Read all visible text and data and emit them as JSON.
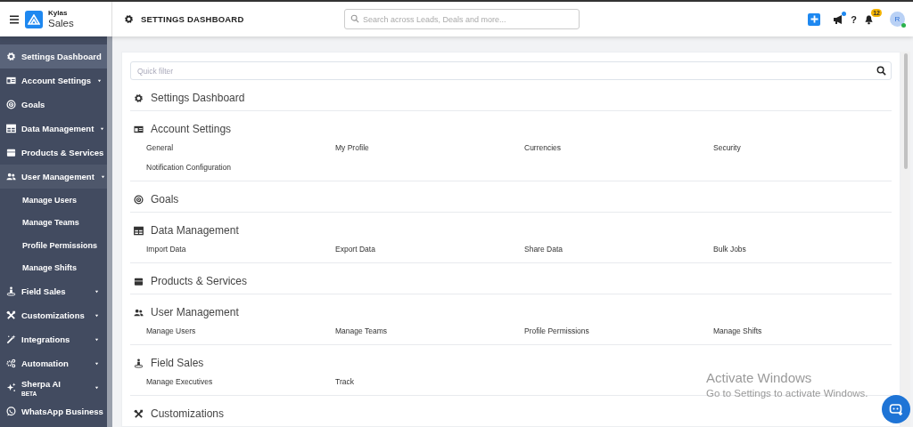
{
  "header": {
    "app_name": "Kylas",
    "product": "Sales",
    "page_title": "SETTINGS DASHBOARD",
    "search": {
      "placeholder": "Search across Leads, Deals and more..."
    },
    "help_label": "?",
    "notification_count": "12",
    "avatar": "R",
    "announcement_unread": true,
    "user_online": true
  },
  "sidebar": {
    "items": [
      {
        "label": "Settings Dashboard",
        "kind": "link",
        "selected": true
      },
      {
        "label": "Account Settings",
        "kind": "menu",
        "selected": false,
        "expanded": false
      },
      {
        "label": "Goals",
        "kind": "link",
        "selected": false
      },
      {
        "label": "Data Management",
        "kind": "menu",
        "selected": false,
        "expanded": false
      },
      {
        "label": "Products & Services",
        "kind": "link",
        "selected": false
      },
      {
        "label": "User Management",
        "kind": "menu",
        "selected": false,
        "expanded": true,
        "children": [
          {
            "label": "Manage Users",
            "selected": false
          },
          {
            "label": "Manage Teams",
            "selected": false
          },
          {
            "label": "Profile Permissions",
            "selected": false
          },
          {
            "label": "Manage Shifts",
            "selected": false
          }
        ]
      },
      {
        "label": "Field Sales",
        "kind": "menu",
        "selected": false,
        "expanded": false
      },
      {
        "label": "Customizations",
        "kind": "menu",
        "selected": false,
        "expanded": false
      },
      {
        "label": "Integrations",
        "kind": "menu",
        "selected": false,
        "expanded": false
      },
      {
        "label": "Automation",
        "kind": "menu",
        "selected": false,
        "expanded": false
      },
      {
        "label": "Sherpa AI",
        "kind": "menu",
        "selected": false,
        "expanded": false,
        "badge": "BETA"
      },
      {
        "label": "WhatsApp Business",
        "kind": "menu",
        "selected": false,
        "expanded": false
      }
    ]
  },
  "main": {
    "quick_filter": {
      "placeholder": "Quick filter"
    },
    "sections": [
      {
        "title": "Settings Dashboard"
      },
      {
        "title": "Account Settings",
        "links": [
          "General",
          "My Profile",
          "Currencies",
          "Security",
          "Notification Configuration"
        ]
      },
      {
        "title": "Goals"
      },
      {
        "title": "Data Management",
        "links": [
          "Import Data",
          "Export Data",
          "Share Data",
          "Bulk Jobs"
        ]
      },
      {
        "title": "Products & Services"
      },
      {
        "title": "User Management",
        "links": [
          "Manage Users",
          "Manage Teams",
          "Profile Permissions",
          "Manage Shifts"
        ]
      },
      {
        "title": "Field Sales",
        "links": [
          "Manage Executives",
          "Track"
        ]
      },
      {
        "title": "Customizations"
      }
    ]
  },
  "os_notice": {
    "title": "Activate Windows",
    "message": "Go to Settings to activate Windows."
  }
}
